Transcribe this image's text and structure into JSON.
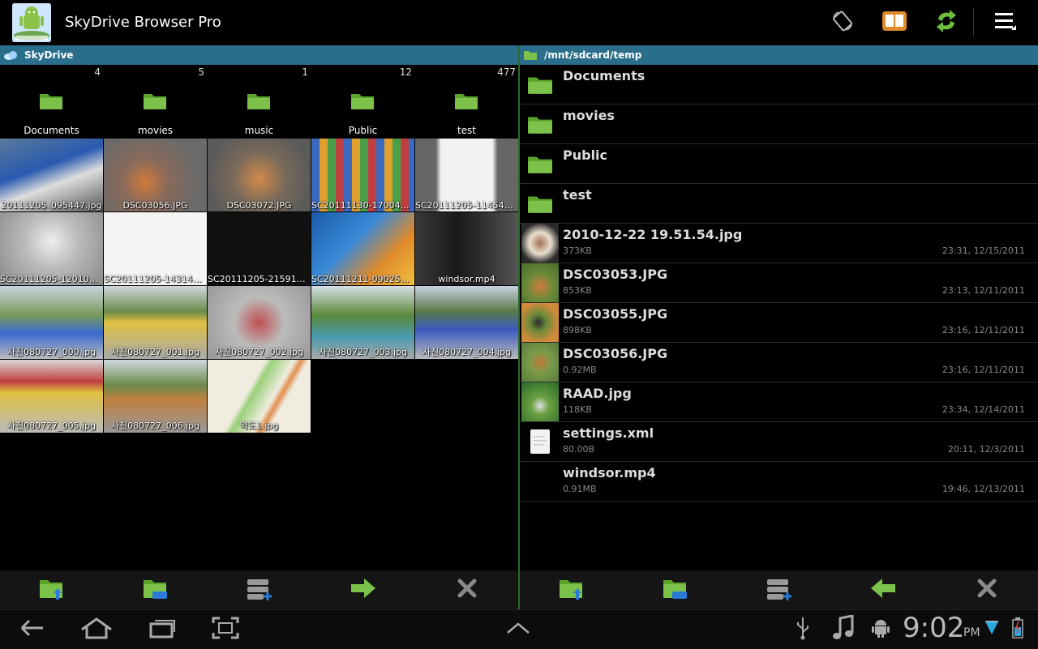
{
  "app": {
    "title": "SkyDrive Browser Pro"
  },
  "left_panel": {
    "header": "SkyDrive",
    "folders": [
      {
        "name": "Documents",
        "count": "4"
      },
      {
        "name": "movies",
        "count": "5"
      },
      {
        "name": "music",
        "count": "1"
      },
      {
        "name": "Public",
        "count": "12"
      },
      {
        "name": "test",
        "count": "477"
      }
    ],
    "thumbnails": [
      {
        "caption": "20111205_095447.jpg"
      },
      {
        "caption": "DSC03056.JPG"
      },
      {
        "caption": "DSC03072.JPG"
      },
      {
        "caption": "SC20111130-170044..."
      },
      {
        "caption": "SC20111205-114543..."
      },
      {
        "caption": "SC20111205-120109..."
      },
      {
        "caption": "SC20111205-143144..."
      },
      {
        "caption": "SC20111205-215918..."
      },
      {
        "caption": "SC20111211-090256..."
      },
      {
        "caption": "windsor.mp4"
      },
      {
        "caption": "사진080727_000.jpg"
      },
      {
        "caption": "사진080727_001.jpg"
      },
      {
        "caption": "사진080727_002.jpg"
      },
      {
        "caption": "사진080727_003.jpg"
      },
      {
        "caption": "사진080727_004.jpg"
      },
      {
        "caption": "사진080727_005.jpg"
      },
      {
        "caption": "사진080727_006.jpg"
      },
      {
        "caption": "약도1.jpg"
      }
    ]
  },
  "right_panel": {
    "header": "/mnt/sdcard/temp",
    "items": [
      {
        "name": "Documents",
        "type": "folder",
        "size": "",
        "date": ""
      },
      {
        "name": "movies",
        "type": "folder",
        "size": "",
        "date": ""
      },
      {
        "name": "Public",
        "type": "folder",
        "size": "",
        "date": ""
      },
      {
        "name": "test",
        "type": "folder",
        "size": "",
        "date": ""
      },
      {
        "name": "2010-12-22 19.51.54.jpg",
        "type": "image",
        "size": "373KB",
        "date": "23:31, 12/15/2011"
      },
      {
        "name": "DSC03053.JPG",
        "type": "image",
        "size": "853KB",
        "date": "23:13, 12/11/2011"
      },
      {
        "name": "DSC03055.JPG",
        "type": "image",
        "size": "898KB",
        "date": "23:16, 12/11/2011"
      },
      {
        "name": "DSC03056.JPG",
        "type": "image",
        "size": "0.92MB",
        "date": "23:16, 12/11/2011"
      },
      {
        "name": "RAAD.jpg",
        "type": "image",
        "size": "118KB",
        "date": "23:34, 12/14/2011"
      },
      {
        "name": "settings.xml",
        "type": "document",
        "size": "80.00B",
        "date": "20:11, 12/3/2011"
      },
      {
        "name": "windsor.mp4",
        "type": "video",
        "size": "0.91MB",
        "date": "19:46, 12/13/2011"
      }
    ]
  },
  "status_bar": {
    "time": "9:02",
    "ampm": "PM"
  },
  "colors": {
    "panel_header": "#2a6e8c",
    "folder_green": "#7cc24a",
    "divider": "#2d6a2d"
  }
}
